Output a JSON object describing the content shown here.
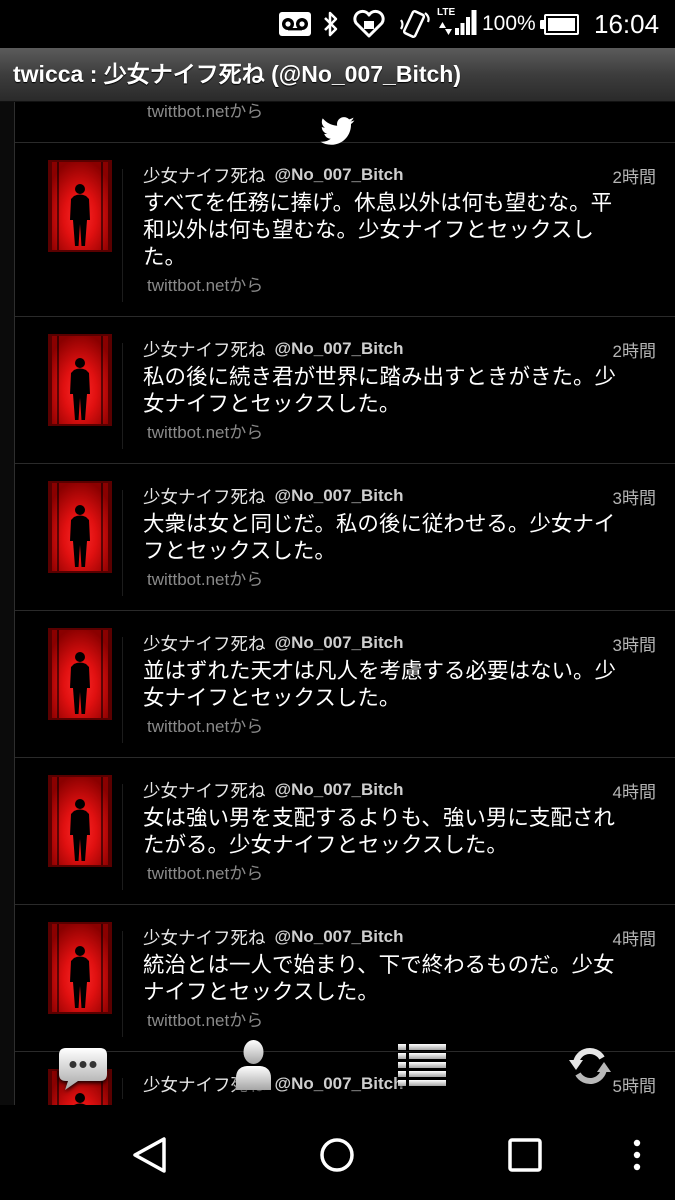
{
  "status_bar": {
    "notification_icons": [
      "voicemail-icon",
      "bluetooth-icon",
      "heart-icon",
      "nfc-icon"
    ],
    "network_type": "LTE",
    "signal_icon": "signal-bars-icon",
    "battery_percent": "100%",
    "battery_level": 1.0,
    "time": "16:04"
  },
  "title_bar": {
    "title": "twicca : 少女ナイフ死ね (@No_007_Bitch)"
  },
  "timeline": {
    "top_partial_source": "twittbot.netから",
    "new_tweets_icon": "twitter-bird-icon",
    "tweets": [
      {
        "name": "少女ナイフ死ね",
        "handle": "@No_007_Bitch",
        "time": "2時間",
        "lines": [
          "すべてを任務に捧げ。休息以外は何も望むな。平",
          "和以外は何も望むな。少女ナイフとセックスし",
          "た。"
        ],
        "source": "twittbot.netから"
      },
      {
        "name": "少女ナイフ死ね",
        "handle": "@No_007_Bitch",
        "time": "2時間",
        "lines": [
          "私の後に続き君が世界に踏み出すときがきた。少",
          "女ナイフとセックスした。"
        ],
        "source": "twittbot.netから"
      },
      {
        "name": "少女ナイフ死ね",
        "handle": "@No_007_Bitch",
        "time": "3時間",
        "lines": [
          "大衆は女と同じだ。私の後に従わせる。少女ナイ",
          "フとセックスした。"
        ],
        "source": "twittbot.netから"
      },
      {
        "name": "少女ナイフ死ね",
        "handle": "@No_007_Bitch",
        "time": "3時間",
        "lines": [
          "並はずれた天才は凡人を考慮する必要はない。少",
          "女ナイフとセックスした。"
        ],
        "source": "twittbot.netから"
      },
      {
        "name": "少女ナイフ死ね",
        "handle": "@No_007_Bitch",
        "time": "4時間",
        "lines": [
          "女は強い男を支配するよりも、強い男に支配され",
          "たがる。少女ナイフとセックスした。"
        ],
        "source": "twittbot.netから"
      },
      {
        "name": "少女ナイフ死ね",
        "handle": "@No_007_Bitch",
        "time": "4時間",
        "lines": [
          "統治とは一人で始まり、下で終わるものだ。少女",
          "ナイフとセックスした。"
        ],
        "source": "twittbot.netから"
      },
      {
        "name": "少女ナイフ死ね",
        "handle": "@No_007_Bitch",
        "time": "5時間"
      }
    ]
  },
  "toolbar": {
    "buttons": [
      {
        "icon": "compose-bubble-icon"
      },
      {
        "icon": "profile-icon"
      },
      {
        "icon": "lists-icon"
      },
      {
        "icon": "refresh-icon"
      }
    ]
  },
  "nav_bar": {
    "buttons": [
      {
        "icon": "back-icon"
      },
      {
        "icon": "home-icon"
      },
      {
        "icon": "recents-icon"
      },
      {
        "icon": "overflow-menu-icon"
      }
    ]
  },
  "colors": {
    "avatar_red": "#e01010",
    "source_text": "#8a8a8a",
    "title_bar": "#3d3d3d"
  }
}
